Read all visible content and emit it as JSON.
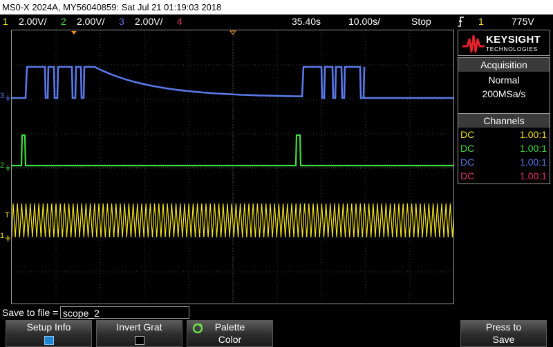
{
  "title_bar": "MS0-X 2024A, MY56040859: Sat Jul 21 01:19:03 2018",
  "status": {
    "ch1": {
      "num": "1",
      "scale": "2.00V/",
      "color": "#f6e51e"
    },
    "ch2": {
      "num": "2",
      "scale": "2.00V/",
      "color": "#3ee23e"
    },
    "ch3": {
      "num": "3",
      "scale": "2.00V/",
      "color": "#5a78e8"
    },
    "ch4": {
      "num": "4",
      "color": "#e0306a"
    },
    "delay": "35.40s",
    "timebase": "10.00s/",
    "run_state": "Stop",
    "trigger_icon": "trigger-edge-icon",
    "trigger_channel": "1",
    "trigger_level": "775V"
  },
  "logo": {
    "brand": "KEYSIGHT",
    "sub": "TECHNOLOGIES",
    "icon": "keysight-wave-icon"
  },
  "acquisition": {
    "title": "Acquisition",
    "mode": "Normal",
    "rate": "200MSa/s"
  },
  "channels": {
    "title": "Channels",
    "rows": [
      {
        "coupling": "DC",
        "probe": "1.00:1",
        "color": "#f6e51e"
      },
      {
        "coupling": "DC",
        "probe": "1.00:1",
        "color": "#3ee23e"
      },
      {
        "coupling": "DC",
        "probe": "1.00:1",
        "color": "#5a78e8"
      },
      {
        "coupling": "DC",
        "probe": "1.00:1",
        "color": "#e0306a"
      }
    ]
  },
  "save": {
    "label": "Save to file =",
    "value": "scope_2"
  },
  "softkeys": {
    "setup_info": "Setup Info",
    "invert_grat": "Invert Grat",
    "palette": "Palette",
    "palette_value": "Color",
    "press_to": "Press to",
    "save": "Save"
  },
  "markers": {
    "ch1": "1",
    "ch2": "2",
    "ch3": "3",
    "trigger": "T"
  }
}
